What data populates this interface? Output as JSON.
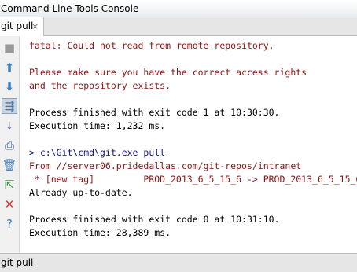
{
  "window": {
    "title": "Command Line Tools Console"
  },
  "tabs": [
    {
      "label": "git pull",
      "close_glyph": "×"
    }
  ],
  "toolbar": {
    "buttons": [
      {
        "name": "stop-icon",
        "glyph": "■",
        "color": "#9a9a9a"
      },
      {
        "name": "arrow-up-icon",
        "glyph": "⬆",
        "color": "#3a7fc2"
      },
      {
        "name": "arrow-down-icon",
        "glyph": "⬇",
        "color": "#3a7fc2"
      },
      {
        "name": "soft-wrap-icon",
        "glyph": "⇶",
        "color": "#4a6fa0"
      },
      {
        "name": "scroll-to-end-icon",
        "glyph": "⤓",
        "color": "#6a5aa8"
      },
      {
        "name": "print-icon",
        "glyph": "⎙",
        "color": "#3c6ea8"
      },
      {
        "name": "clear-trash-icon",
        "glyph": "🗑",
        "color": "#4a7fb8"
      },
      {
        "name": "export-icon",
        "glyph": "⇱",
        "color": "#3e9a3e"
      },
      {
        "name": "close-icon",
        "glyph": "✕",
        "color": "#d23c3c"
      },
      {
        "name": "help-icon",
        "glyph": "?",
        "color": "#3a7fc2"
      }
    ]
  },
  "console": {
    "lines": [
      {
        "text": "fatal: Could not read from remote repository.",
        "kind": "err"
      },
      {
        "text": "",
        "kind": "out"
      },
      {
        "text": "Please make sure you have the correct access rights",
        "kind": "err"
      },
      {
        "text": "and the repository exists.",
        "kind": "err"
      },
      {
        "text": "",
        "kind": "out"
      },
      {
        "text": "Process finished with exit code 1 at 10:30:30.",
        "kind": "out"
      },
      {
        "text": "Execution time: 1,232 ms.",
        "kind": "out"
      },
      {
        "text": "",
        "kind": "out"
      },
      {
        "text": "> c:\\Git\\cmd\\git.exe pull",
        "kind": "inp"
      },
      {
        "text": "From //server06.pridedallas.com/git-repos/intranet",
        "kind": "err"
      },
      {
        "text": " * [new tag]         PROD_2013_6_5_15_6 -> PROD_2013_6_5_15_6",
        "kind": "err"
      },
      {
        "text": "Already up-to-date.",
        "kind": "out"
      },
      {
        "text": "",
        "kind": "out"
      },
      {
        "text": "Process finished with exit code 0 at 10:31:10.",
        "kind": "out"
      },
      {
        "text": "Execution time: 28,389 ms.",
        "kind": "out"
      }
    ]
  },
  "statusbar": {
    "text": "git pull"
  }
}
